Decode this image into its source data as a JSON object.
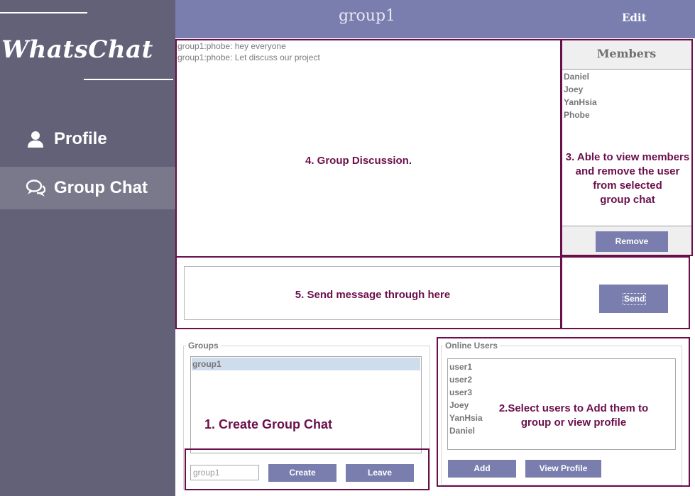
{
  "app": {
    "name": "WhatsChat"
  },
  "sidebar": {
    "items": [
      {
        "label": "Profile",
        "icon": "user-icon"
      },
      {
        "label": "Group Chat",
        "icon": "chat-bubbles-icon"
      }
    ]
  },
  "header": {
    "title": "group1",
    "edit_label": "Edit"
  },
  "chat": {
    "messages": [
      "group1:phobe: hey everyone",
      "group1:phobe: Let discuss our project"
    ]
  },
  "members": {
    "title": "Members",
    "list": [
      "Daniel",
      "Joey",
      "YanHsia",
      "Phobe"
    ],
    "remove_label": "Remove"
  },
  "send": {
    "send_label": "Send"
  },
  "groups": {
    "legend": "Groups",
    "list": [
      "group1"
    ],
    "input_value": "group1",
    "create_label": "Create",
    "leave_label": "Leave"
  },
  "online_users": {
    "legend": "Online Users",
    "list": [
      "user1",
      "user2",
      "user3",
      "Joey",
      "YanHsia",
      "Daniel"
    ],
    "add_label": "Add",
    "view_profile_label": "View Profile"
  },
  "annotations": {
    "a1": "1. Create Group Chat",
    "a2_line1": "2.Select users to Add them to",
    "a2_line2": "group or view profile",
    "a3_line1": "3. Able to view members",
    "a3_line2": "and remove the user",
    "a3_line3": "from selected",
    "a3_line4": "group chat",
    "a4": "4. Group Discussion.",
    "a5": "5. Send message through here"
  },
  "colors": {
    "sidebar": "#626178",
    "sidebar_active": "#7a798c",
    "header": "#7a7eaf",
    "button": "#7a7eaf",
    "annotation": "#6b0f4b",
    "selected_row": "#cfdceb"
  }
}
